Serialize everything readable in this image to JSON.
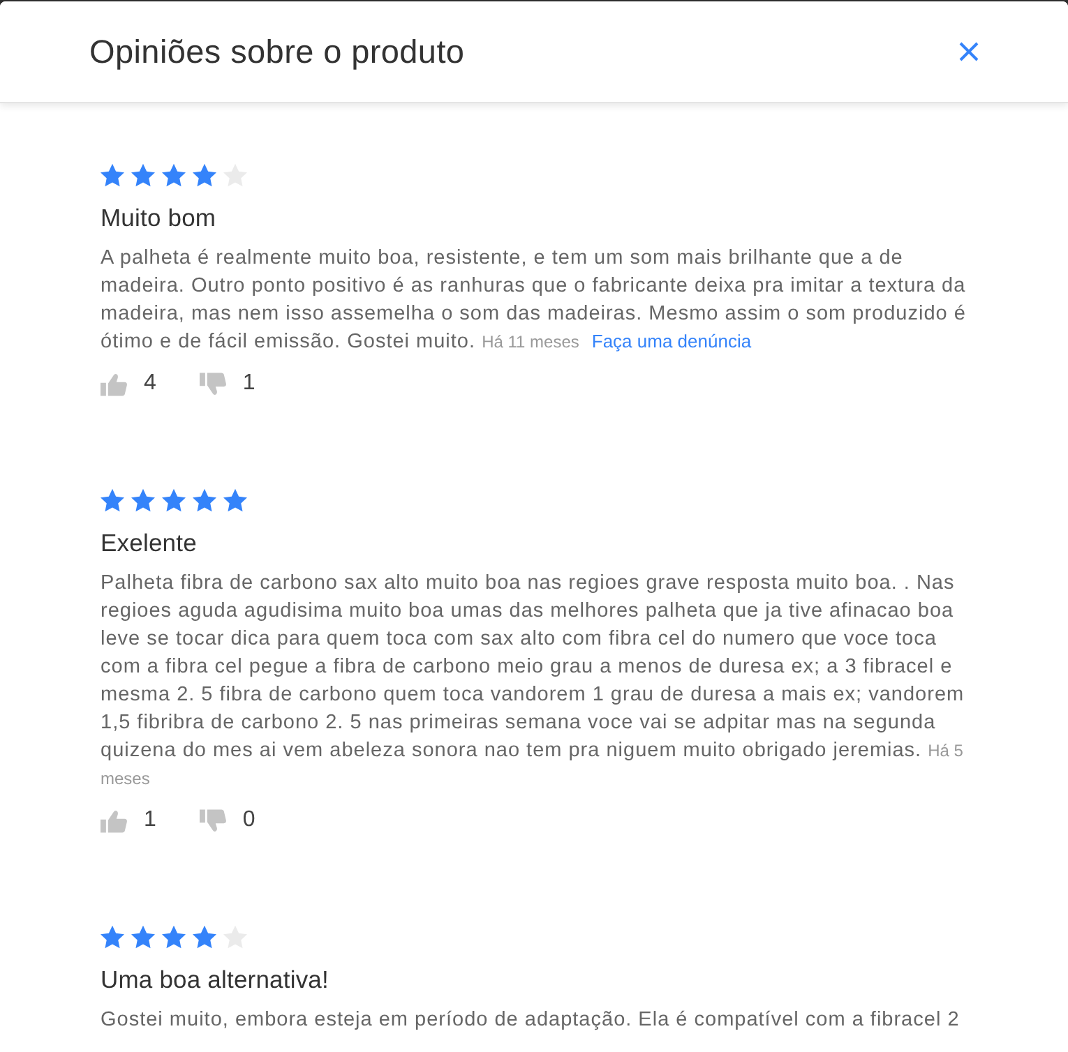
{
  "dialog": {
    "title": "Opiniões sobre o produto"
  },
  "reviews": [
    {
      "stars": 4,
      "title": "Muito bom",
      "text": "A palheta é realmente muito boa, resistente, e tem um som mais brilhante que a de madeira. Outro ponto positivo é as ranhuras que o fabricante deixa pra imitar a textura da madeira, mas nem isso assemelha o som das madeiras. Mesmo assim o som produzido é ótimo e de fácil emissão. Gostei muito.",
      "date": "Há 11 meses",
      "report_link": "Faça uma denúncia",
      "likes": "4",
      "dislikes": "1"
    },
    {
      "stars": 5,
      "title": "Exelente",
      "text": "Palheta fibra de carbono sax alto muito boa nas regioes grave resposta muito boa. . Nas regioes aguda agudisima muito boa umas das melhores palheta que ja tive afinacao boa leve se tocar dica para quem toca com sax alto com fibra cel do numero que voce toca com a fibra cel pegue a fibra de carbono meio grau a menos de duresa ex; a 3 fibracel e mesma 2. 5 fibra de carbono quem toca vandorem 1 grau de duresa a mais ex; vandorem 1,5 fibribra de carbono 2. 5 nas primeiras semana voce vai se adpitar mas na segunda quizena do mes ai vem abeleza sonora nao tem pra niguem muito obrigado jeremias.",
      "date": "Há 5 meses",
      "likes": "1",
      "dislikes": "0"
    },
    {
      "stars": 4,
      "title": "Uma boa alternativa!",
      "text": "Gostei muito, embora esteja em período de adaptação. Ela é compatível com a fibracel 2"
    }
  ]
}
